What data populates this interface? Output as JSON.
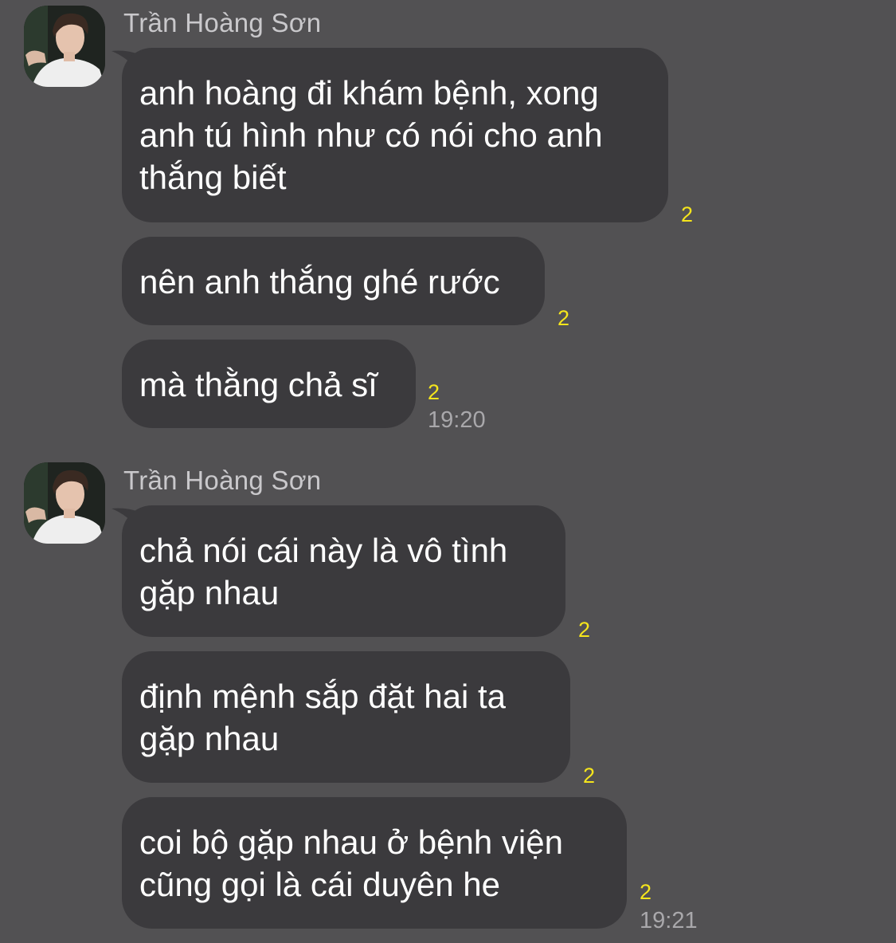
{
  "colors": {
    "background": "#525153",
    "bubble": "#3b3a3d",
    "message_text": "#ffffff",
    "sender_name": "#c9c8cb",
    "unread_count": "#f5e51c",
    "timestamp": "#a9a8ab"
  },
  "groups": [
    {
      "sender": "Trần Hoàng Sơn",
      "avatar_icon": "user-avatar-photo",
      "time": "19:20",
      "messages": [
        {
          "text": "anh hoàng đi khám bệnh, xong\nanh tú hình như có nói cho anh\nthắng biết",
          "unread": "2"
        },
        {
          "text": "nên anh thắng ghé rước",
          "unread": "2"
        },
        {
          "text": "mà thằng chả sĩ",
          "unread": "2"
        }
      ]
    },
    {
      "sender": "Trần Hoàng Sơn",
      "avatar_icon": "user-avatar-photo",
      "time": "19:21",
      "messages": [
        {
          "text": "chả nói cái này là vô tình\ngặp nhau",
          "unread": "2"
        },
        {
          "text": "định mệnh sắp đặt hai ta\ngặp nhau",
          "unread": "2"
        },
        {
          "text": "coi bộ gặp nhau ở bệnh viện\ncũng gọi là cái duyên he",
          "unread": "2"
        }
      ]
    }
  ]
}
